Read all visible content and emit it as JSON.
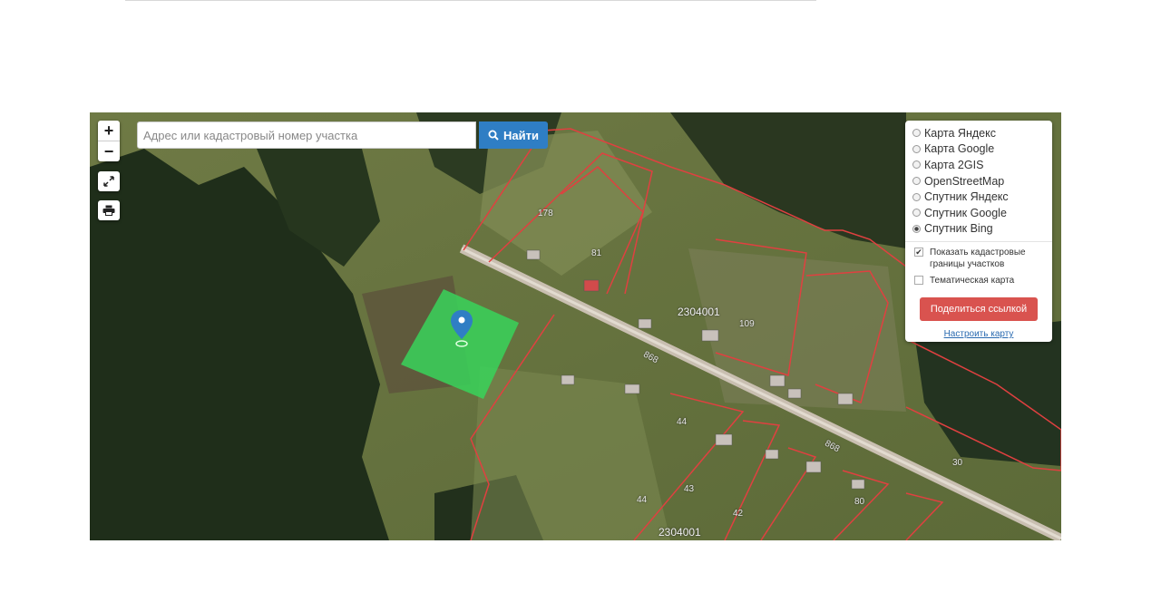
{
  "search": {
    "placeholder": "Адрес или кадастровый номер участка",
    "button_label": "Найти"
  },
  "controls": {
    "zoom_in": "+",
    "zoom_out": "−"
  },
  "layers": [
    {
      "label": "Карта Яндекс",
      "selected": false
    },
    {
      "label": "Карта Google",
      "selected": false
    },
    {
      "label": "Карта 2GIS",
      "selected": false
    },
    {
      "label": "OpenStreetMap",
      "selected": false
    },
    {
      "label": "Спутник Яндекс",
      "selected": false
    },
    {
      "label": "Спутник Google",
      "selected": false
    },
    {
      "label": "Спутник Bing",
      "selected": true
    }
  ],
  "options": {
    "cadastral_borders": {
      "label": "Показать кадастровые границы участков",
      "checked": true
    },
    "thematic_map": {
      "label": "Тематическая карта",
      "checked": false
    }
  },
  "share_button": "Поделиться ссылкой",
  "configure_link": "Настроить карту",
  "map": {
    "parcel_labels": [
      "178",
      "81",
      "109",
      "44",
      "43",
      "42",
      "44",
      "80",
      "30",
      "868",
      "868"
    ],
    "quarter_labels": [
      "2304001",
      "2304001"
    ],
    "highlight_color": "#38d35a",
    "border_color": "#e04040"
  }
}
